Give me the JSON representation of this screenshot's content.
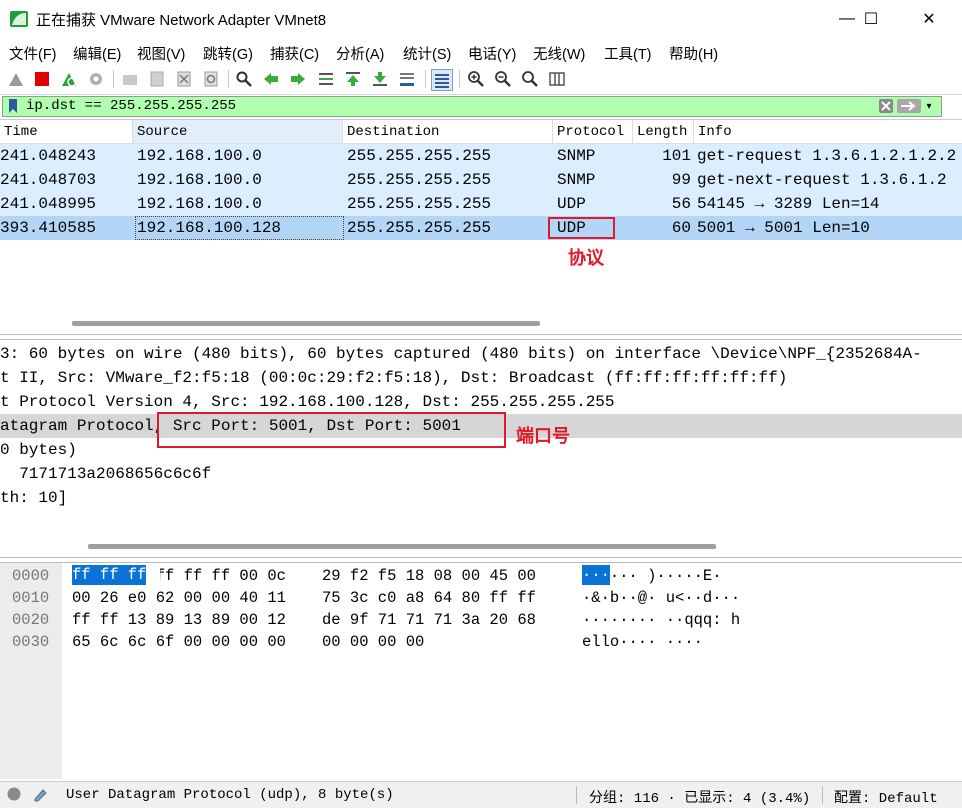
{
  "window": {
    "title": "正在捕获 VMware Network Adapter VMnet8",
    "minimize": "—",
    "maximize": "☐",
    "close": "✕"
  },
  "menu": [
    "文件(F)",
    "编辑(E)",
    "视图(V)",
    "跳转(G)",
    "捕获(C)",
    "分析(A)",
    "统计(S)",
    "电话(Y)",
    "无线(W)",
    "工具(T)",
    "帮助(H)"
  ],
  "toolbar": {
    "icons": [
      "shark-fin-icon",
      "stop-icon",
      "restart-icon",
      "options-gear-icon",
      "open-folder-icon",
      "save-file-icon",
      "close-file-icon",
      "reload-icon",
      "find-icon",
      "back-arrow-icon",
      "forward-arrow-icon",
      "goto-packet-icon",
      "first-packet-icon",
      "last-packet-icon",
      "autoscroll-icon",
      "colorize-icon",
      "zoom-in-icon",
      "zoom-out-icon",
      "zoom-normal-icon",
      "resize-columns-icon"
    ]
  },
  "filter": {
    "value": "ip.dst == 255.255.255.255",
    "bg_color": "#afffaf"
  },
  "packet_list": {
    "columns": [
      "Time",
      "Source",
      "Destination",
      "Protocol",
      "Length",
      "Info"
    ],
    "rows": [
      {
        "time": "241.048243",
        "source": "192.168.100.0",
        "destination": "255.255.255.255",
        "protocol": "SNMP",
        "length": "101",
        "info": "get-request 1.3.6.1.2.1.2.2"
      },
      {
        "time": "241.048703",
        "source": "192.168.100.0",
        "destination": "255.255.255.255",
        "protocol": "SNMP",
        "length": "99",
        "info": "get-next-request 1.3.6.1.2"
      },
      {
        "time": "241.048995",
        "source": "192.168.100.0",
        "destination": "255.255.255.255",
        "protocol": "UDP",
        "length": "56",
        "info": "54145 → 3289 Len=14"
      },
      {
        "time": "393.410585",
        "source": "192.168.100.128",
        "destination": "255.255.255.255",
        "protocol": "UDP",
        "length": "60",
        "info": "5001 → 5001 Len=10"
      }
    ],
    "row_color": "#daeeff",
    "selected_color": "#b3d6f7"
  },
  "annotations": {
    "protocol_label": "协议",
    "port_label": "端口号",
    "color": "#e0182b"
  },
  "details": {
    "lines": [
      "3: 60 bytes on wire (480 bits), 60 bytes captured (480 bits) on interface \\Device\\NPF_{2352684A-",
      "t II, Src: VMware_f2:f5:18 (00:0c:29:f2:f5:18), Dst: Broadcast (ff:ff:ff:ff:ff:ff)",
      "t Protocol Version 4, Src: 192.168.100.128, Dst: 255.255.255.255",
      "atagram Protocol, Src Port: 5001, Dst Port: 5001",
      "0 bytes)",
      "  7171713a2068656c6c6f",
      "th: 10]"
    ]
  },
  "bytes": {
    "offsets": [
      "0000",
      "0010",
      "0020",
      "0030"
    ],
    "hex_a": [
      "ff ff ff ff ff ff 00 0c",
      "00 26 e0 62 00 00 40 11",
      "ff ff 13 89 13 89 00 12",
      "65 6c 6c 6f 00 00 00 00"
    ],
    "hex_b": [
      "29 f2 f5 18 08 00 45 00",
      "75 3c c0 a8 64 80 ff ff",
      "de 9f 71 71 71 3a 20 68",
      "00 00 00 00"
    ],
    "ascii": [
      "······ )·····E·",
      "·&·b··@· u<··d···",
      "········ ··qqq: h",
      "ello···· ····"
    ],
    "first_hex_highlight": "ff ff ff",
    "first_ascii_highlight": "···"
  },
  "status": {
    "protocol": "User Datagram Protocol (udp), 8 byte(s)",
    "packets": "分组: 116 · 已显示: 4 (3.4%)",
    "profile": "配置: Default"
  }
}
